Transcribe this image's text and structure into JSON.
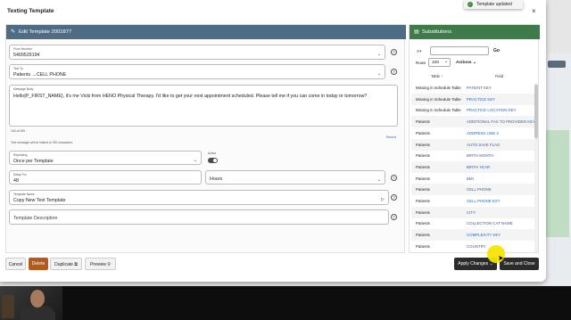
{
  "modal": {
    "title": "Texting Template",
    "close": "×"
  },
  "toast": {
    "text": "Template updated"
  },
  "left_panel": {
    "header": "Edit Template 2001877",
    "from_number": {
      "label": "From Number",
      "value": "5409529194"
    },
    "text_to": {
      "label": "Text To",
      "value": "Patients →CELL PHONE"
    },
    "message": {
      "label": "Message Body",
      "value": "Hello{P_FIRST_NAME}, it's me Vicki from HENO Physical Therapy. I'd like to get your next appointment scheduled. Please tell me if you can come in today or tomorrow?",
      "count": "164 of 255",
      "link": "Recent"
    },
    "limit_note": "Text message will be limited to 300 characters",
    "repeating": {
      "label": "Repeating",
      "value": "Once per Template"
    },
    "active": {
      "label": "Active",
      "on": true
    },
    "delay_for": {
      "label": "Delay For",
      "value": "48"
    },
    "delay_unit": {
      "value": "Hours"
    },
    "template_name": {
      "label": "Template Name",
      "value": "Copy New Text Template"
    },
    "template_description": {
      "placeholder": "Template Description"
    }
  },
  "footer": {
    "cancel": "Cancel",
    "delete": "Delete",
    "duplicate": "Duplicate",
    "preview": "Preview",
    "apply": "Apply Changes",
    "save": "Save and Close"
  },
  "right_panel": {
    "header": "Substitutions",
    "go": "Go",
    "rows_label": "Rows",
    "rows_value": "100",
    "actions": "Actions",
    "col_table": "Table ↑",
    "col_field": "Field",
    "rows": [
      {
        "table": "Missing in Schedule Table",
        "field": "PATIENT KEY"
      },
      {
        "table": "Missing in Schedule Table",
        "field": "PRACTICE KEY"
      },
      {
        "table": "Missing in Schedule Table",
        "field": "PRACTICE LOCATION KEY"
      },
      {
        "table": "Patients",
        "field": "ADDITIONAL FAX TO PROVIDER KEY"
      },
      {
        "table": "Patients",
        "field": "ADDRESS LINE 2"
      },
      {
        "table": "Patients",
        "field": "AUTO SAVE FLAG"
      },
      {
        "table": "Patients",
        "field": "BIRTH MONTH"
      },
      {
        "table": "Patients",
        "field": "BIRTH YEAR"
      },
      {
        "table": "Patients",
        "field": "BMI"
      },
      {
        "table": "Patients",
        "field": "CELL PHONE"
      },
      {
        "table": "Patients",
        "field": "CELL PHONE EXT"
      },
      {
        "table": "Patients",
        "field": "CITY"
      },
      {
        "table": "Patients",
        "field": "COLLECTION CAT NAME"
      },
      {
        "table": "Patients",
        "field": "COMPLEXITY KEY"
      },
      {
        "table": "Patients",
        "field": "COUNTRY"
      }
    ]
  }
}
